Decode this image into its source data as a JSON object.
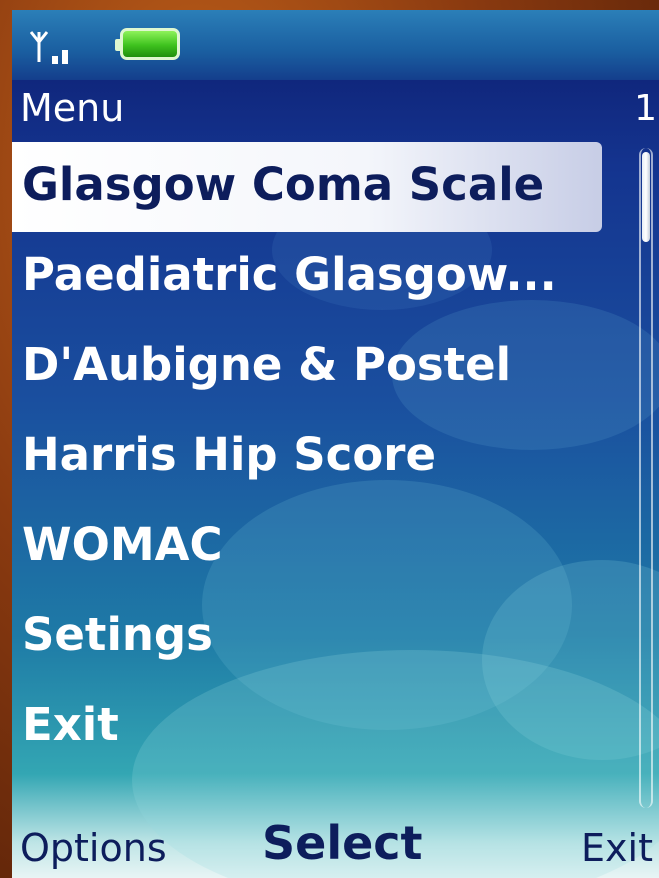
{
  "title": "Menu",
  "page_indicator": "1",
  "menu_items": [
    {
      "label": "Glasgow Coma Scale",
      "selected": true
    },
    {
      "label": "Paediatric Glasgow...",
      "selected": false
    },
    {
      "label": "D'Aubigne & Postel",
      "selected": false
    },
    {
      "label": "Harris Hip Score",
      "selected": false
    },
    {
      "label": "WOMAC",
      "selected": false
    },
    {
      "label": "Setings",
      "selected": false
    },
    {
      "label": "Exit",
      "selected": false
    }
  ],
  "softkeys": {
    "left": "Options",
    "middle": "Select",
    "right": "Exit"
  },
  "status": {
    "signal_icon": "signal-strength-icon",
    "battery_icon": "battery-icon"
  },
  "colors": {
    "selection_text": "#0d1d5c",
    "background_top": "#0d1c6e",
    "background_bottom": "#33a6b3"
  }
}
